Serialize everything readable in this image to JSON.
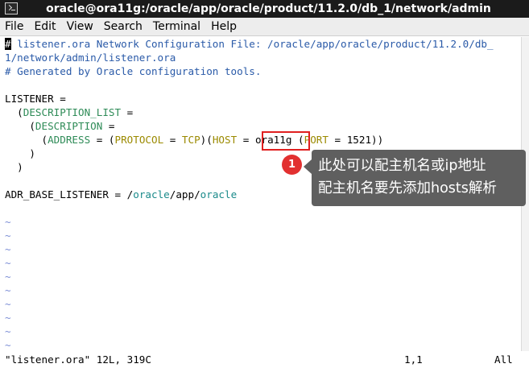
{
  "window": {
    "title": "oracle@ora11g:/oracle/app/oracle/product/11.2.0/db_1/network/admin"
  },
  "menu": [
    "File",
    "Edit",
    "View",
    "Search",
    "Terminal",
    "Help"
  ],
  "editor": {
    "comment1_hash": "#",
    "comment1_rest": " listener.ora Network Configuration File: /oracle/app/oracle/product/11.2.0/db_",
    "comment1_wrap": "1/network/admin/listener.ora",
    "comment2": "# Generated by Oracle configuration tools.",
    "l_listener": "LISTENER =",
    "l_desc_list_indent": "  (",
    "l_desc_list_kw": "DESCRIPTION_LIST",
    "l_desc_list_eq": " =",
    "l_desc_indent": "    (",
    "l_desc_kw": "DESCRIPTION",
    "l_desc_eq": " =",
    "addr_indent": "      (",
    "addr_kw": "ADDRESS",
    "addr_eq": " = (",
    "protocol_kw": "PROTOCOL",
    "protocol_eq": " = ",
    "protocol_val": "TCP",
    "paren_open_host": ")(",
    "host_kw": "HOST",
    "host_eq": " = ",
    "host_val": "ora11g",
    "port_open": " (",
    "port_kw": "PORT",
    "port_eq": " = 1521))",
    "close1": "    )",
    "close2": "  )",
    "adr_lhs": "ADR_BASE_LISTENER = /",
    "adr_oracle1": "oracle",
    "adr_app": "/app/",
    "adr_oracle2": "oracle",
    "tilde": "~"
  },
  "annotation": {
    "badge": "1",
    "line1": "此处可以配主机名或ip地址",
    "line2": "配主机名要先添加hosts解析"
  },
  "status": {
    "file": "\"listener.ora\" 12L, 319C",
    "position": "1,1",
    "scroll": "All"
  },
  "colors": {
    "highlight": "#e02020",
    "callout_bg": "#5f5f5f",
    "badge": "#e23030"
  }
}
